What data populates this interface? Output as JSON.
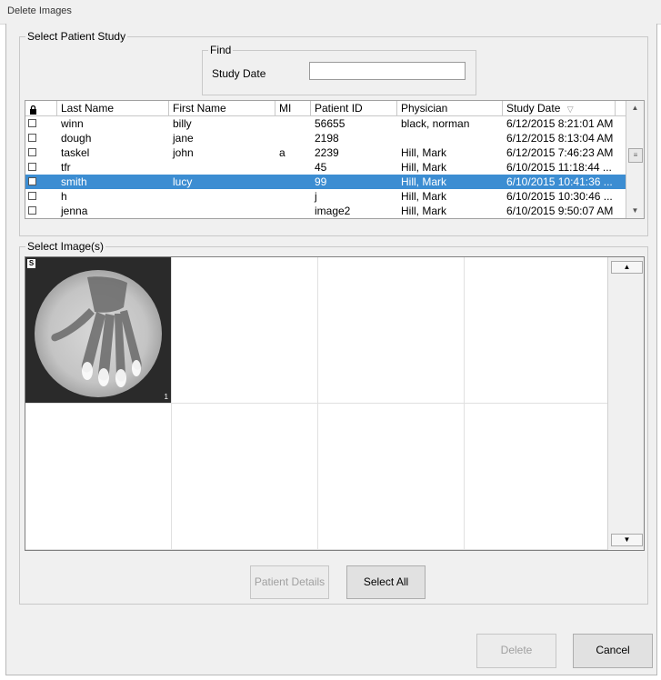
{
  "window": {
    "title": "Delete Images"
  },
  "patient_study": {
    "group_title": "Select Patient Study",
    "find": {
      "title": "Find",
      "study_date_label": "Study Date",
      "study_date_value": ""
    },
    "columns": [
      "Last Name",
      "First Name",
      "MI",
      "Patient ID",
      "Physician",
      "Study Date"
    ],
    "sort_indicator": "▽",
    "rows": [
      {
        "last": "winn",
        "first": "billy",
        "mi": "",
        "pid": "56655",
        "physician": "black, norman",
        "date": "6/12/2015 8:21:01 AM",
        "selected": false
      },
      {
        "last": "dough",
        "first": "jane",
        "mi": "",
        "pid": "2198",
        "physician": "",
        "date": "6/12/2015 8:13:04 AM",
        "selected": false
      },
      {
        "last": "taskel",
        "first": "john",
        "mi": "a",
        "pid": "2239",
        "physician": "Hill, Mark",
        "date": "6/12/2015 7:46:23 AM",
        "selected": false
      },
      {
        "last": "tfr",
        "first": "",
        "mi": "",
        "pid": "45",
        "physician": "Hill, Mark",
        "date": "6/10/2015 11:18:44 ...",
        "selected": false
      },
      {
        "last": "smith",
        "first": "lucy",
        "mi": "",
        "pid": "99",
        "physician": "Hill, Mark",
        "date": "6/10/2015 10:41:36 ...",
        "selected": true
      },
      {
        "last": "h",
        "first": "",
        "mi": "",
        "pid": "j",
        "physician": "Hill, Mark",
        "date": "6/10/2015 10:30:46 ...",
        "selected": false
      },
      {
        "last": "jenna",
        "first": "",
        "mi": "",
        "pid": "image2",
        "physician": "Hill, Mark",
        "date": "6/10/2015 9:50:07 AM",
        "selected": false
      }
    ]
  },
  "images": {
    "group_title": "Select Image(s)",
    "first_image_badge": "S",
    "first_image_number": "1"
  },
  "buttons": {
    "patient_details": "Patient Details",
    "select_all": "Select All",
    "delete": "Delete",
    "cancel": "Cancel"
  }
}
